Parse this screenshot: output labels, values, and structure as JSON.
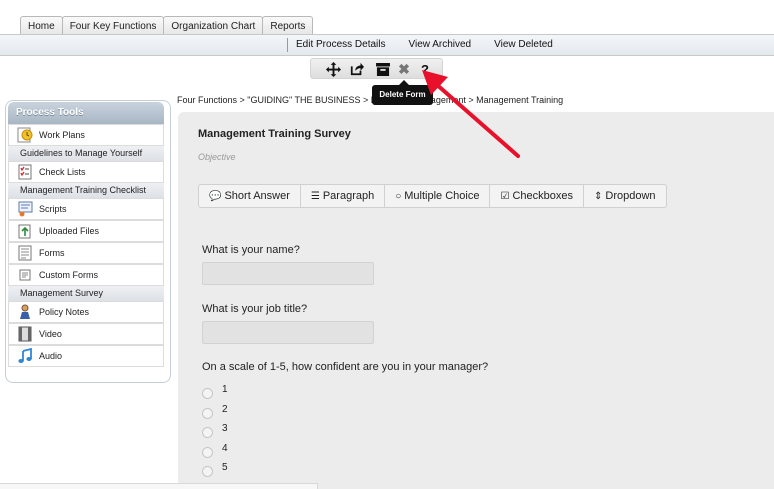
{
  "tabs": [
    "Home",
    "Four Key Functions",
    "Organization Chart",
    "Reports"
  ],
  "subnav": [
    "Edit Process Details",
    "View Archived",
    "View Deleted"
  ],
  "toolbar": {
    "icons": [
      "move-icon",
      "share-icon",
      "archive-icon",
      "delete-icon",
      "help-icon"
    ],
    "tooltip": "Delete Form"
  },
  "breadcrumb": "Four Functions > \"GUIDING\" THE BUSINESS > Employee Management > Management Training",
  "sidebar": {
    "title": "Process Tools",
    "items": [
      {
        "label": "Work Plans",
        "type": "item",
        "icon": "work-plans-icon"
      },
      {
        "label": "Guidelines to Manage Yourself",
        "type": "sub"
      },
      {
        "label": "Check Lists",
        "type": "item",
        "icon": "checklist-icon"
      },
      {
        "label": "Management Training Checklist",
        "type": "sub"
      },
      {
        "label": "Scripts",
        "type": "item",
        "icon": "scripts-icon"
      },
      {
        "label": "Uploaded Files",
        "type": "item",
        "icon": "uploaded-files-icon"
      },
      {
        "label": "Forms",
        "type": "item",
        "icon": "forms-icon"
      },
      {
        "label": "Custom Forms",
        "type": "item",
        "icon": "custom-forms-icon"
      },
      {
        "label": "Management Survey",
        "type": "sub"
      },
      {
        "label": "Policy Notes",
        "type": "item",
        "icon": "policy-notes-icon"
      },
      {
        "label": "Video",
        "type": "item",
        "icon": "video-icon"
      },
      {
        "label": "Audio",
        "type": "item",
        "icon": "audio-icon"
      }
    ]
  },
  "form": {
    "title": "Management Training Survey",
    "objective": "Objective",
    "question_types": [
      "Short Answer",
      "Paragraph",
      "Multiple Choice",
      "Checkboxes",
      "Dropdown"
    ],
    "questions": [
      {
        "label": "What is your name?",
        "kind": "text"
      },
      {
        "label": "What is your job title?",
        "kind": "text"
      },
      {
        "label": "On a scale of 1-5, how confident are you in your manager?",
        "kind": "radio",
        "options": [
          "1",
          "2",
          "3",
          "4",
          "5"
        ]
      }
    ]
  },
  "colors": {
    "arrow": "#e8102a",
    "sidebar_header": "#a8b6c4"
  }
}
